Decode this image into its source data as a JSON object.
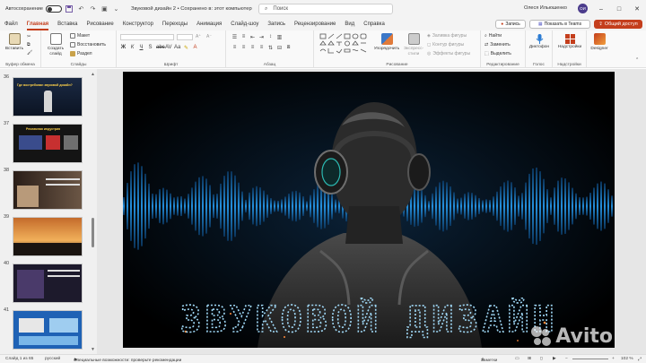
{
  "titlebar": {
    "autosave_label": "Автосохранение",
    "autosave_state": "off",
    "document_title": "Звуковой дизайн 2  •  Сохранено в: этот компьютер",
    "search_placeholder": "Поиск",
    "user_name": "Олеся Ильюшенко",
    "avatar_initials": "ОИ"
  },
  "tabs": [
    "Файл",
    "Главная",
    "Вставка",
    "Рисование",
    "Конструктор",
    "Переходы",
    "Анимация",
    "Слайд-шоу",
    "Запись",
    "Рецензирование",
    "Вид",
    "Справка"
  ],
  "active_tab": "Главная",
  "header_buttons": {
    "record": "Запись",
    "teams": "Показать в Teams",
    "share": "Общий доступ"
  },
  "ribbon": {
    "clipboard": {
      "paste": "Вставить",
      "label": "Буфер обмена"
    },
    "slides": {
      "new_slide": "Создать слайд",
      "layout": "Макет",
      "reset": "Восстановить",
      "section": "Раздел",
      "label": "Слайды"
    },
    "font": {
      "label": "Шрифт"
    },
    "paragraph": {
      "label": "Абзац"
    },
    "drawing": {
      "arrange": "Упорядочить",
      "quick_styles": "Экспресс-стили",
      "shape_fill": "Заливка фигуры",
      "shape_outline": "Контур фигуры",
      "shape_effects": "Эффекты фигуры",
      "label": "Рисование"
    },
    "editing": {
      "find": "Найти",
      "replace": "Заменить",
      "select": "Выделить",
      "label": "Редактирование"
    },
    "voice": {
      "dictate": "Диктофон",
      "label": "Голос"
    },
    "addins": {
      "addins": "Надстройки",
      "label": "Надстройки"
    },
    "designer": {
      "designer": "Designer"
    }
  },
  "thumbnails": [
    {
      "number": "36",
      "caption": "Где востребован звуковой дизайн?"
    },
    {
      "number": "37",
      "caption": "Рекламная индустрия"
    },
    {
      "number": "38",
      "caption": ""
    },
    {
      "number": "39",
      "caption": ""
    },
    {
      "number": "40",
      "caption": ""
    },
    {
      "number": "41",
      "caption": ""
    }
  ],
  "slide": {
    "title": "ЗВУКОВОЙ ДИЗАЙН"
  },
  "statusbar": {
    "slide_counter": "Слайд 1 из 65",
    "language": "русский",
    "accessibility": "Специальные возможности: проверьте рекомендации",
    "notes": "Заметки",
    "zoom": "102 %"
  },
  "colors": {
    "accent": "#c43e1c",
    "wave_blue": "#1d8fe0",
    "title_text": "#9fd7f5"
  },
  "watermark": "Avito"
}
